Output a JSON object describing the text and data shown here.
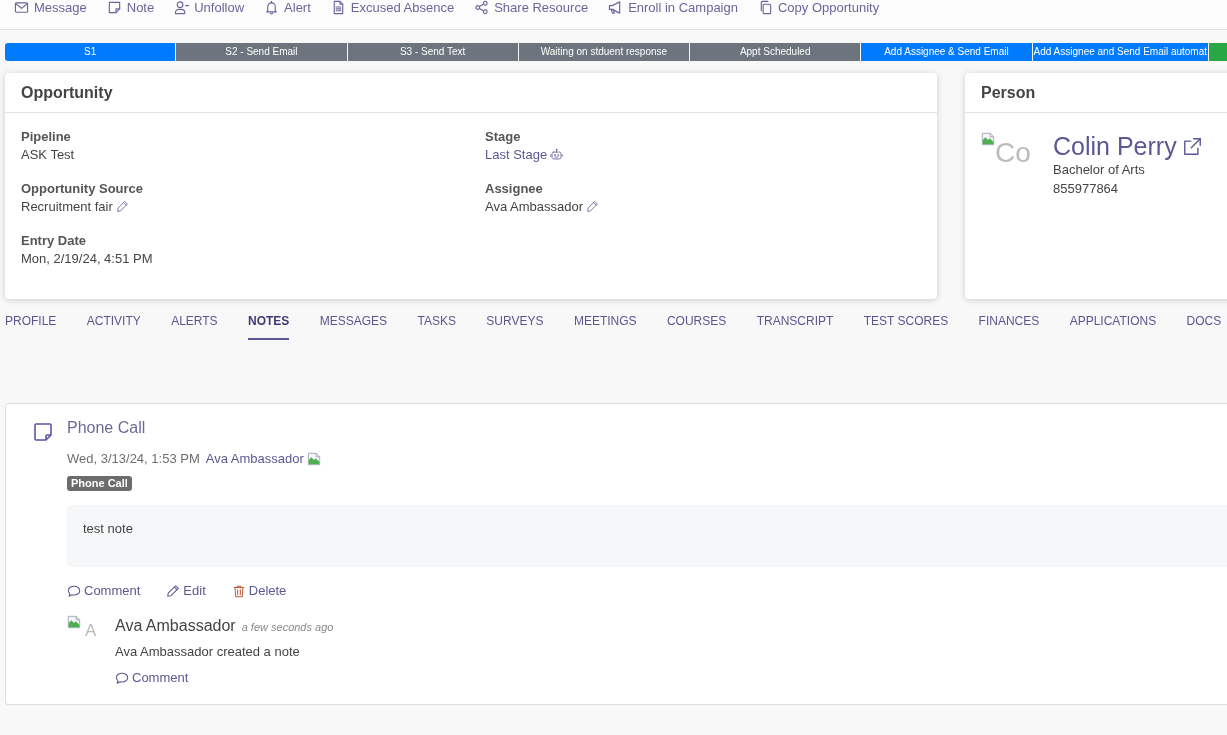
{
  "toolbar": [
    "Message",
    "Note",
    "Unfollow",
    "Alert",
    "Excused Absence",
    "Share Resource",
    "Enroll in Campaign",
    "Copy Opportunity"
  ],
  "stages": [
    {
      "label": "S1",
      "color": "#007bff"
    },
    {
      "label": "S2 - Send Email",
      "color": "#6c757d"
    },
    {
      "label": "S3 - Send Text",
      "color": "#6c757d"
    },
    {
      "label": "Waiting on stduent response",
      "color": "#6c757d"
    },
    {
      "label": "Appt Scheduled",
      "color": "#6c757d"
    },
    {
      "label": "Add Assignee & Send Email",
      "color": "#007bff"
    },
    {
      "label": "Add Assignee and Send Email automat",
      "color": "#007bff"
    },
    {
      "color": "#28a745"
    }
  ],
  "opportunity": {
    "title": "Opportunity",
    "left_fields": [
      {
        "label": "Pipeline",
        "value": "ASK Test",
        "kind": "plain"
      },
      {
        "label": "Opportunity Source",
        "value": "Recruitment fair",
        "kind": "editable"
      },
      {
        "label": "Entry Date",
        "value": "Mon, 2/19/24, 4:51 PM",
        "kind": "plain"
      }
    ],
    "right_fields": [
      {
        "label": "Stage",
        "value": "Last Stage",
        "kind": "automated-link"
      },
      {
        "label": "Assignee",
        "value": "Ava Ambassador",
        "kind": "editable"
      }
    ]
  },
  "person": {
    "title": "Person",
    "avatar_alt": "Co",
    "name": "Colin Perry",
    "program": "Bachelor of Arts",
    "id_number": "855977864"
  },
  "tabs": [
    {
      "label": "PROFILE",
      "selected": false
    },
    {
      "label": "ACTIVITY",
      "selected": false
    },
    {
      "label": "ALERTS",
      "selected": false
    },
    {
      "label": "NOTES",
      "selected": true
    },
    {
      "label": "MESSAGES",
      "selected": false
    },
    {
      "label": "TASKS",
      "selected": false
    },
    {
      "label": "SURVEYS",
      "selected": false
    },
    {
      "label": "MEETINGS",
      "selected": false
    },
    {
      "label": "COURSES",
      "selected": false
    },
    {
      "label": "TRANSCRIPT",
      "selected": false
    },
    {
      "label": "TEST SCORES",
      "selected": false
    },
    {
      "label": "FINANCES",
      "selected": false
    },
    {
      "label": "APPLICATIONS",
      "selected": false
    },
    {
      "label": "DOCS",
      "selected": false
    }
  ],
  "note": {
    "title": "Phone Call",
    "date": "Wed, 3/13/24, 1:53 PM",
    "author": "Ava Ambassador",
    "badge": "Phone Call",
    "body": "test note",
    "actions": [
      "Comment",
      "Edit",
      "Delete"
    ],
    "activity": {
      "avatar_alt": "A",
      "author": "Ava Ambassador",
      "time": "a few seconds ago",
      "text": "Ava Ambassador created a note",
      "action": "Comment"
    }
  }
}
